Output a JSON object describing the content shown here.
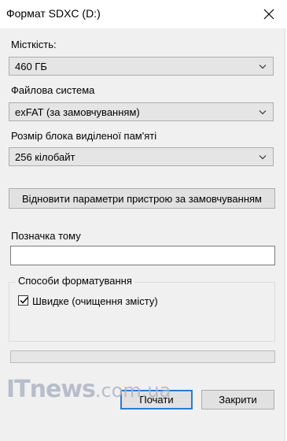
{
  "window": {
    "title": "Формат SDXC (D:)"
  },
  "capacity": {
    "label": "Місткість:",
    "value": "460 ГБ"
  },
  "filesystem": {
    "label": "Файлова система",
    "value": "exFAT (за замовчуванням)"
  },
  "allocation": {
    "label": "Розмір блока виділеної пам'яті",
    "value": "256 кілобайт"
  },
  "restore_button": "Відновити параметри пристрою за замовчуванням",
  "volume": {
    "label": "Позначка тому",
    "value": ""
  },
  "format_options": {
    "title": "Способи форматування",
    "quick": {
      "label": "Швидке (очищення змісту)",
      "checked": true
    }
  },
  "progress": {
    "value": 0
  },
  "buttons": {
    "start": "Почати",
    "close": "Закрити"
  },
  "watermark": {
    "main": "ITnews",
    "suffix": ".com.ua"
  },
  "icons": {
    "close": "close-icon",
    "dropdown": "chevron-down-icon",
    "check": "checkmark-icon"
  }
}
